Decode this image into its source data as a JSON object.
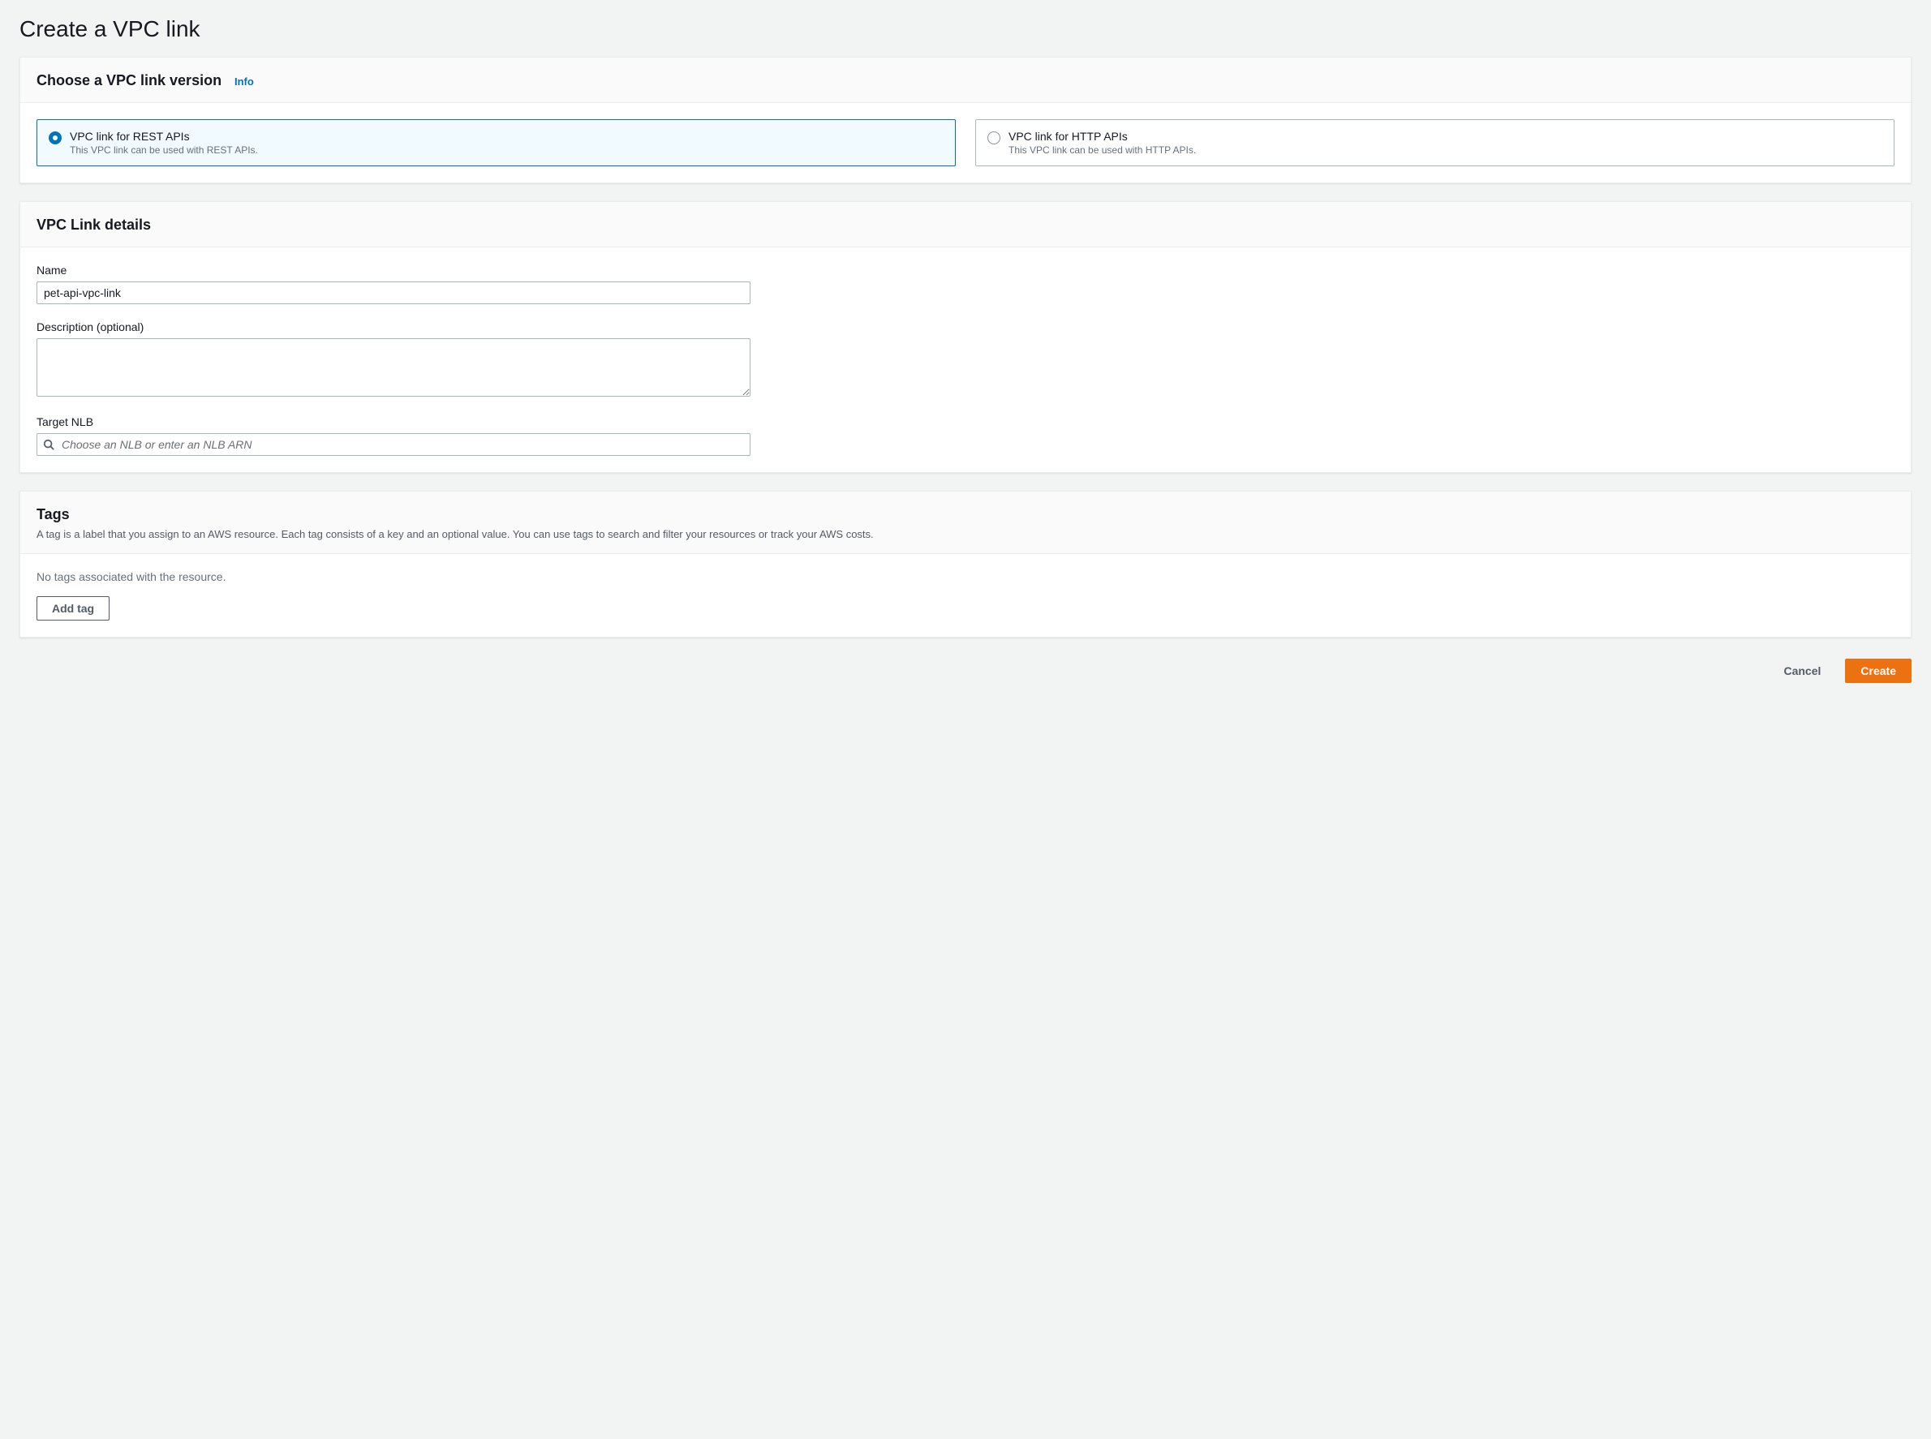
{
  "page": {
    "title": "Create a VPC link"
  },
  "version_panel": {
    "heading": "Choose a VPC link version",
    "info": "Info",
    "tiles": [
      {
        "title": "VPC link for REST APIs",
        "desc": "This VPC link can be used with REST APIs.",
        "selected": true
      },
      {
        "title": "VPC link for HTTP APIs",
        "desc": "This VPC link can be used with HTTP APIs.",
        "selected": false
      }
    ]
  },
  "details_panel": {
    "heading": "VPC Link details",
    "name_label": "Name",
    "name_value": "pet-api-vpc-link",
    "desc_label": "Description (optional)",
    "desc_value": "",
    "target_label": "Target NLB",
    "target_placeholder": "Choose an NLB or enter an NLB ARN"
  },
  "tags_panel": {
    "heading": "Tags",
    "subtitle": "A tag is a label that you assign to an AWS resource. Each tag consists of a key and an optional value. You can use tags to search and filter your resources or track your AWS costs.",
    "empty": "No tags associated with the resource.",
    "add_button": "Add tag"
  },
  "footer": {
    "cancel": "Cancel",
    "create": "Create"
  }
}
